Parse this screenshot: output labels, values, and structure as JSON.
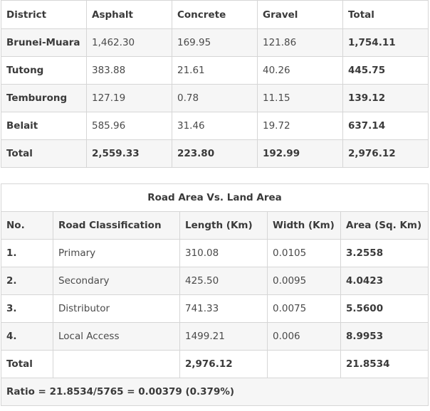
{
  "district_table": {
    "headers": [
      "District",
      "Asphalt",
      "Concrete",
      "Gravel",
      "Total"
    ],
    "rows": [
      [
        "Brunei-Muara",
        "1,462.30",
        "169.95",
        "121.86",
        "1,754.11"
      ],
      [
        "Tutong",
        "383.88",
        "21.61",
        "40.26",
        "445.75"
      ],
      [
        "Temburong",
        "127.19",
        "0.78",
        "11.15",
        "139.12"
      ],
      [
        "Belait",
        "585.96",
        "31.46",
        "19.72",
        "637.14"
      ]
    ],
    "total_row": [
      "Total",
      "2,559.33",
      "223.80",
      "192.99",
      "2,976.12"
    ]
  },
  "road_table": {
    "title": "Road Area Vs. Land Area",
    "headers": [
      "No.",
      "Road Classification",
      "Length (Km)",
      "Width (Km)",
      "Area (Sq. Km)"
    ],
    "rows": [
      [
        "1.",
        "Primary",
        "310.08",
        "0.0105",
        "3.2558"
      ],
      [
        "2.",
        "Secondary",
        "425.50",
        "0.0095",
        "4.0423"
      ],
      [
        "3.",
        "Distributor",
        "741.33",
        "0.0075",
        "5.5600"
      ],
      [
        "4.",
        "Local Access",
        "1499.21",
        "0.006",
        "8.9953"
      ]
    ],
    "total_row": [
      "Total",
      "",
      "2,976.12",
      "",
      "21.8534"
    ],
    "ratio": "Ratio = 21.8534/5765 = 0.00379 (0.379%)"
  }
}
